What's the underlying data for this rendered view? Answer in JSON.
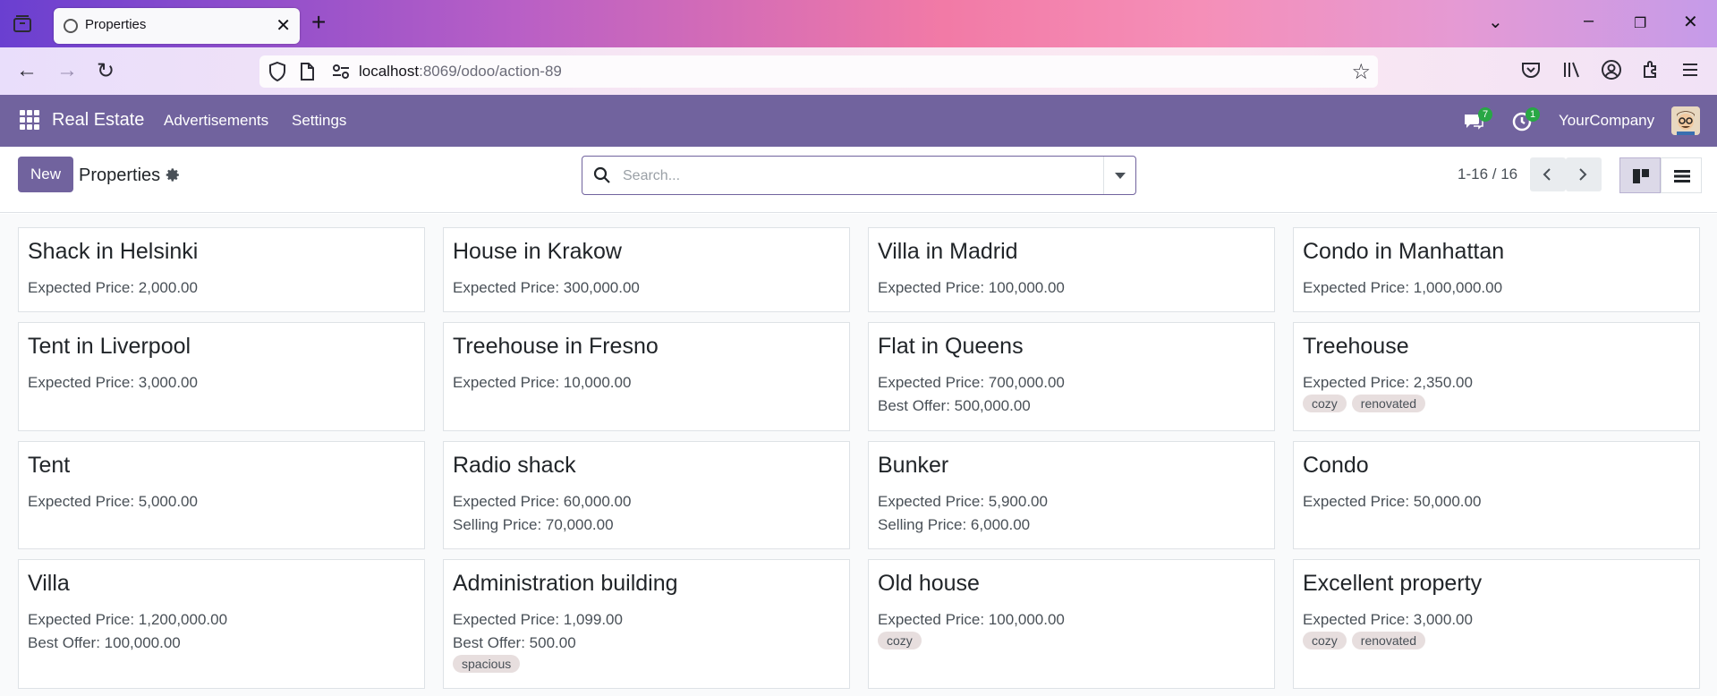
{
  "browser": {
    "tab_title": "Properties",
    "url_host": "localhost",
    "url_rest": ":8069/odoo/action-89"
  },
  "app": {
    "brand": "Real Estate",
    "menu": [
      "Advertisements",
      "Settings"
    ],
    "messages_count": "7",
    "activities_count": "1",
    "company": "YourCompany",
    "accent_color": "#71639e"
  },
  "control_panel": {
    "new_label": "New",
    "title": "Properties",
    "search_placeholder": "Search...",
    "pager": "1-16 / 16"
  },
  "cards": [
    {
      "name": "Shack in Helsinki",
      "lines": [
        "Expected Price: 2,000.00"
      ],
      "tags": []
    },
    {
      "name": "House in Krakow",
      "lines": [
        "Expected Price: 300,000.00"
      ],
      "tags": []
    },
    {
      "name": "Villa in Madrid",
      "lines": [
        "Expected Price: 100,000.00"
      ],
      "tags": []
    },
    {
      "name": "Condo in Manhattan",
      "lines": [
        "Expected Price: 1,000,000.00"
      ],
      "tags": []
    },
    {
      "name": "Tent in Liverpool",
      "lines": [
        "Expected Price: 3,000.00"
      ],
      "tags": []
    },
    {
      "name": "Treehouse in Fresno",
      "lines": [
        "Expected Price: 10,000.00"
      ],
      "tags": []
    },
    {
      "name": "Flat in Queens",
      "lines": [
        "Expected Price: 700,000.00",
        "Best Offer: 500,000.00"
      ],
      "tags": []
    },
    {
      "name": "Treehouse",
      "lines": [
        "Expected Price: 2,350.00"
      ],
      "tags": [
        "cozy",
        "renovated"
      ]
    },
    {
      "name": "Tent",
      "lines": [
        "Expected Price: 5,000.00"
      ],
      "tags": []
    },
    {
      "name": "Radio shack",
      "lines": [
        "Expected Price: 60,000.00",
        "Selling Price: 70,000.00"
      ],
      "tags": []
    },
    {
      "name": "Bunker",
      "lines": [
        "Expected Price: 5,900.00",
        "Selling Price: 6,000.00"
      ],
      "tags": []
    },
    {
      "name": "Condo",
      "lines": [
        "Expected Price: 50,000.00"
      ],
      "tags": []
    },
    {
      "name": "Villa",
      "lines": [
        "Expected Price: 1,200,000.00",
        "Best Offer: 100,000.00"
      ],
      "tags": []
    },
    {
      "name": "Administration building",
      "lines": [
        "Expected Price: 1,099.00",
        "Best Offer: 500.00"
      ],
      "tags": [
        "spacious"
      ]
    },
    {
      "name": "Old house",
      "lines": [
        "Expected Price: 100,000.00"
      ],
      "tags": [
        "cozy"
      ]
    },
    {
      "name": "Excellent property",
      "lines": [
        "Expected Price: 3,000.00"
      ],
      "tags": [
        "cozy",
        "renovated"
      ]
    }
  ]
}
